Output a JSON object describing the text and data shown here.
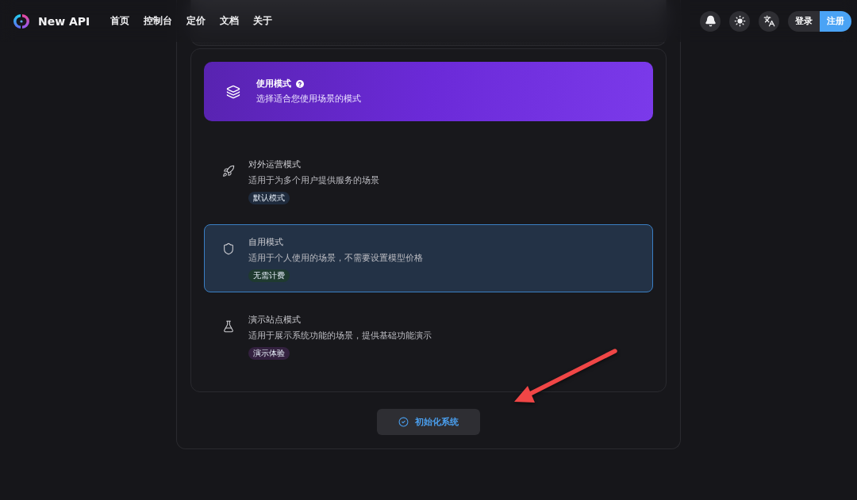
{
  "nav": {
    "brand": "New API",
    "links": [
      "首页",
      "控制台",
      "定价",
      "文档",
      "关于"
    ],
    "auth": [
      {
        "label": "登录",
        "kind": "secondary"
      },
      {
        "label": "注册",
        "kind": "primary"
      }
    ]
  },
  "setup": {
    "header": {
      "title": "使用模式",
      "subtitle": "选择适合您使用场景的模式"
    },
    "modes": [
      {
        "kind": "operation",
        "title": "对外运营模式",
        "description": "适用于为多个用户提供服务的场景",
        "tag": {
          "label": "默认模式",
          "color": "#1f2b3d"
        },
        "selected": false
      },
      {
        "kind": "personal",
        "title": "自用模式",
        "description": "适用于个人使用的场景，不需要设置模型价格",
        "tag": {
          "label": "无需计费",
          "color": "#1f3a30"
        },
        "selected": true
      },
      {
        "kind": "demo",
        "title": "演示站点模式",
        "description": "适用于展示系统功能的场景，提供基础功能演示",
        "tag": {
          "label": "演示体验",
          "color": "#33213f"
        },
        "selected": false
      }
    ],
    "submit": "初始化系统"
  }
}
